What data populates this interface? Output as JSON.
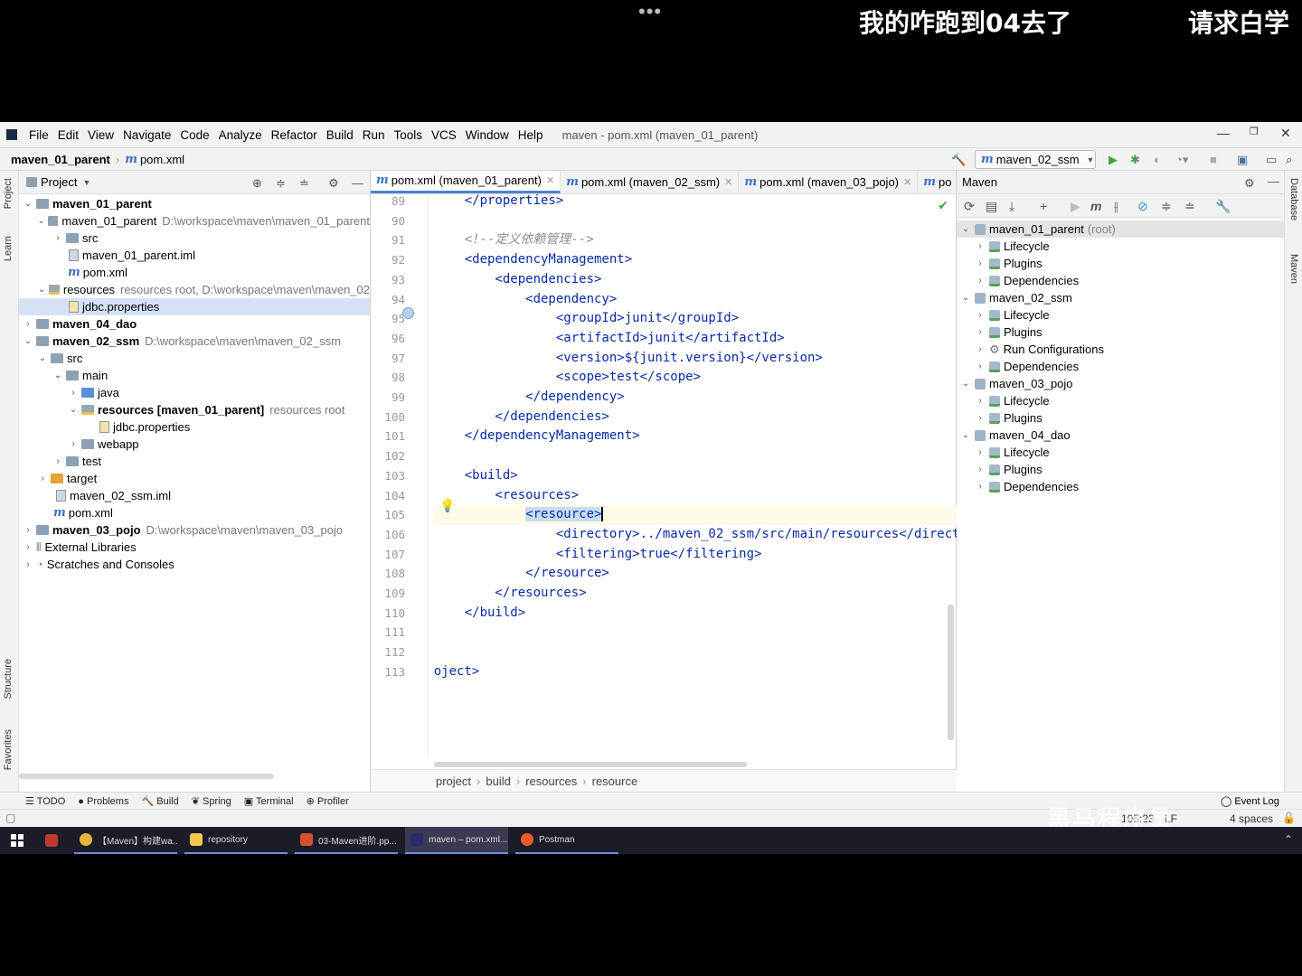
{
  "overlay": {
    "dots": "•••",
    "text_left": "我的咋跑到04去了",
    "text_right": "请求白学"
  },
  "menu": [
    "File",
    "Edit",
    "View",
    "Navigate",
    "Code",
    "Analyze",
    "Refactor",
    "Build",
    "Run",
    "Tools",
    "VCS",
    "Window",
    "Help"
  ],
  "window_title": "maven - pom.xml (maven_01_parent)",
  "navbar": {
    "project": "maven_01_parent",
    "file": "pom.xml",
    "run_config": "maven_02_ssm"
  },
  "project_panel": {
    "title": "Project",
    "tree": [
      {
        "label": "maven_01_parent",
        "bold": true,
        "hint": ""
      },
      {
        "label": "maven_01_parent",
        "bold": false,
        "hint": "D:\\workspace\\maven\\maven_01_parent"
      },
      {
        "label": "src",
        "bold": false,
        "hint": ""
      },
      {
        "label": "maven_01_parent.iml",
        "bold": false,
        "hint": ""
      },
      {
        "label": "pom.xml",
        "bold": false,
        "hint": ""
      },
      {
        "label": "resources",
        "bold": false,
        "hint": "resources root,  D:\\workspace\\maven\\maven_02"
      },
      {
        "label": "jdbc.properties",
        "bold": false,
        "hint": ""
      },
      {
        "label": "maven_04_dao",
        "bold": true,
        "hint": ""
      },
      {
        "label": "maven_02_ssm",
        "bold": true,
        "hint": "D:\\workspace\\maven\\maven_02_ssm"
      },
      {
        "label": "src",
        "bold": false,
        "hint": ""
      },
      {
        "label": "main",
        "bold": false,
        "hint": ""
      },
      {
        "label": "java",
        "bold": false,
        "hint": ""
      },
      {
        "label": "resources [maven_01_parent]",
        "bold": false,
        "hint": "resources root"
      },
      {
        "label": "jdbc.properties",
        "bold": false,
        "hint": ""
      },
      {
        "label": "webapp",
        "bold": false,
        "hint": ""
      },
      {
        "label": "test",
        "bold": false,
        "hint": ""
      },
      {
        "label": "target",
        "bold": false,
        "hint": ""
      },
      {
        "label": "maven_02_ssm.iml",
        "bold": false,
        "hint": ""
      },
      {
        "label": "pom.xml",
        "bold": false,
        "hint": ""
      },
      {
        "label": "maven_03_pojo",
        "bold": true,
        "hint": "D:\\workspace\\maven\\maven_03_pojo"
      },
      {
        "label": "External Libraries",
        "bold": false,
        "hint": ""
      },
      {
        "label": "Scratches and Consoles",
        "bold": false,
        "hint": ""
      }
    ]
  },
  "tabs": [
    "pom.xml (maven_01_parent)",
    "pom.xml (maven_02_ssm)",
    "pom.xml (maven_03_pojo)",
    "po"
  ],
  "editor": {
    "line_numbers": [
      "89",
      "90",
      "91",
      "92",
      "93",
      "94",
      "95",
      "96",
      "97",
      "98",
      "99",
      "100",
      "101",
      "102",
      "103",
      "104",
      "105",
      "106",
      "107",
      "108",
      "109",
      "110",
      "111",
      "112",
      "113"
    ],
    "lines": [
      "    </properties>",
      "",
      "    <!--定义依赖管理-->",
      "    <dependencyManagement>",
      "        <dependencies>",
      "            <dependency>",
      "                <groupId>junit</groupId>",
      "                <artifactId>junit</artifactId>",
      "                <version>${junit.version}</version>",
      "                <scope>test</scope>",
      "            </dependency>",
      "        </dependencies>",
      "    </dependencyManagement>",
      "",
      "    <build>",
      "        <resources>",
      "            <resource>",
      "                <directory>../maven_02_ssm/src/main/resources</directo",
      "                <filtering>true</filtering>",
      "            </resource>",
      "        </resources>",
      "    </build>",
      "",
      "",
      "</project>"
    ],
    "breadcrumbs": [
      "project",
      "build",
      "resources",
      "resource"
    ]
  },
  "maven_panel": {
    "title": "Maven",
    "tree": [
      {
        "label": "maven_01_parent",
        "suffix": "(root)"
      },
      {
        "label": "Lifecycle",
        "suffix": ""
      },
      {
        "label": "Plugins",
        "suffix": ""
      },
      {
        "label": "Dependencies",
        "suffix": ""
      },
      {
        "label": "maven_02_ssm",
        "suffix": ""
      },
      {
        "label": "Lifecycle",
        "suffix": ""
      },
      {
        "label": "Plugins",
        "suffix": ""
      },
      {
        "label": "Run Configurations",
        "suffix": ""
      },
      {
        "label": "Dependencies",
        "suffix": ""
      },
      {
        "label": "maven_03_pojo",
        "suffix": ""
      },
      {
        "label": "Lifecycle",
        "suffix": ""
      },
      {
        "label": "Plugins",
        "suffix": ""
      },
      {
        "label": "maven_04_dao",
        "suffix": ""
      },
      {
        "label": "Lifecycle",
        "suffix": ""
      },
      {
        "label": "Plugins",
        "suffix": ""
      },
      {
        "label": "Dependencies",
        "suffix": ""
      }
    ]
  },
  "side_labels": {
    "project": "Project",
    "learn": "Learn",
    "structure": "Structure",
    "favorites": "Favorites",
    "database": "Database",
    "maven": "Maven"
  },
  "tool_windows": [
    "TODO",
    "Problems",
    "Build",
    "Spring",
    "Terminal",
    "Profiler"
  ],
  "status": {
    "position": "105:23",
    "line_sep": "LF",
    "indent": "4 spaces",
    "event_log": "Event Log"
  },
  "taskbar": [
    "【Maven】构建wa...",
    "repository",
    "03-Maven进阶.pp...",
    "maven – pom.xml...",
    "Postman"
  ],
  "watermark": "黑马程序员"
}
